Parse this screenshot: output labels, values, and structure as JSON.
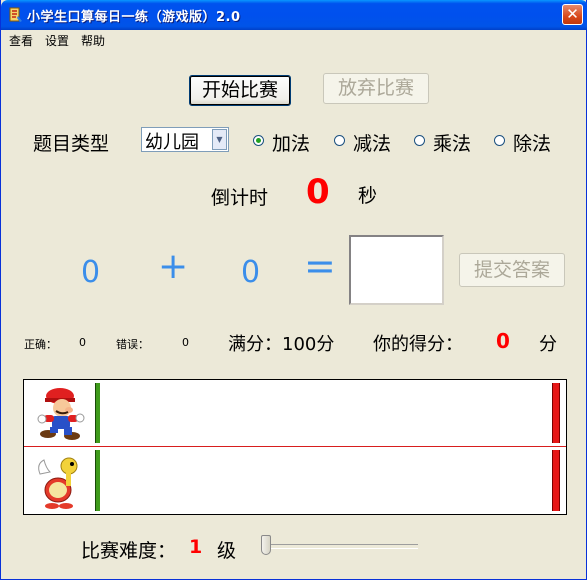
{
  "window": {
    "title": "小学生口算每日一练（游戏版）2.0",
    "close_glyph": "✕"
  },
  "menu": [
    "查看",
    "设置",
    "帮助"
  ],
  "buttons": {
    "start": "开始比赛",
    "give_up": "放弃比赛",
    "submit": "提交答案"
  },
  "question_type": {
    "label": "题目类型",
    "selected": "幼儿园",
    "options": [
      "加法",
      "减法",
      "乘法",
      "除法"
    ],
    "checked": "加法"
  },
  "countdown": {
    "label": "倒计时",
    "value": "0",
    "unit": "秒"
  },
  "problem": {
    "left": "0",
    "operator": "+",
    "right": "0",
    "equals": "=",
    "answer": ""
  },
  "score": {
    "correct_label": "正确：",
    "correct": "0",
    "wrong_label": "错误：",
    "wrong": "0",
    "full_label": "满分：100分",
    "yours_label": "你的得分：",
    "yours": "0",
    "unit": "分"
  },
  "race": {
    "player_icon": "mario-icon",
    "opponent_icon": "koopa-paratroopa-icon",
    "player_progress": 0,
    "opponent_progress": 0
  },
  "difficulty": {
    "label": "比赛难度：",
    "value": "1",
    "unit": "级",
    "slider_level": 0
  },
  "colors": {
    "accent_blue": "#3b8eea",
    "red": "#ff0000",
    "titlebar": "#0053ee"
  }
}
